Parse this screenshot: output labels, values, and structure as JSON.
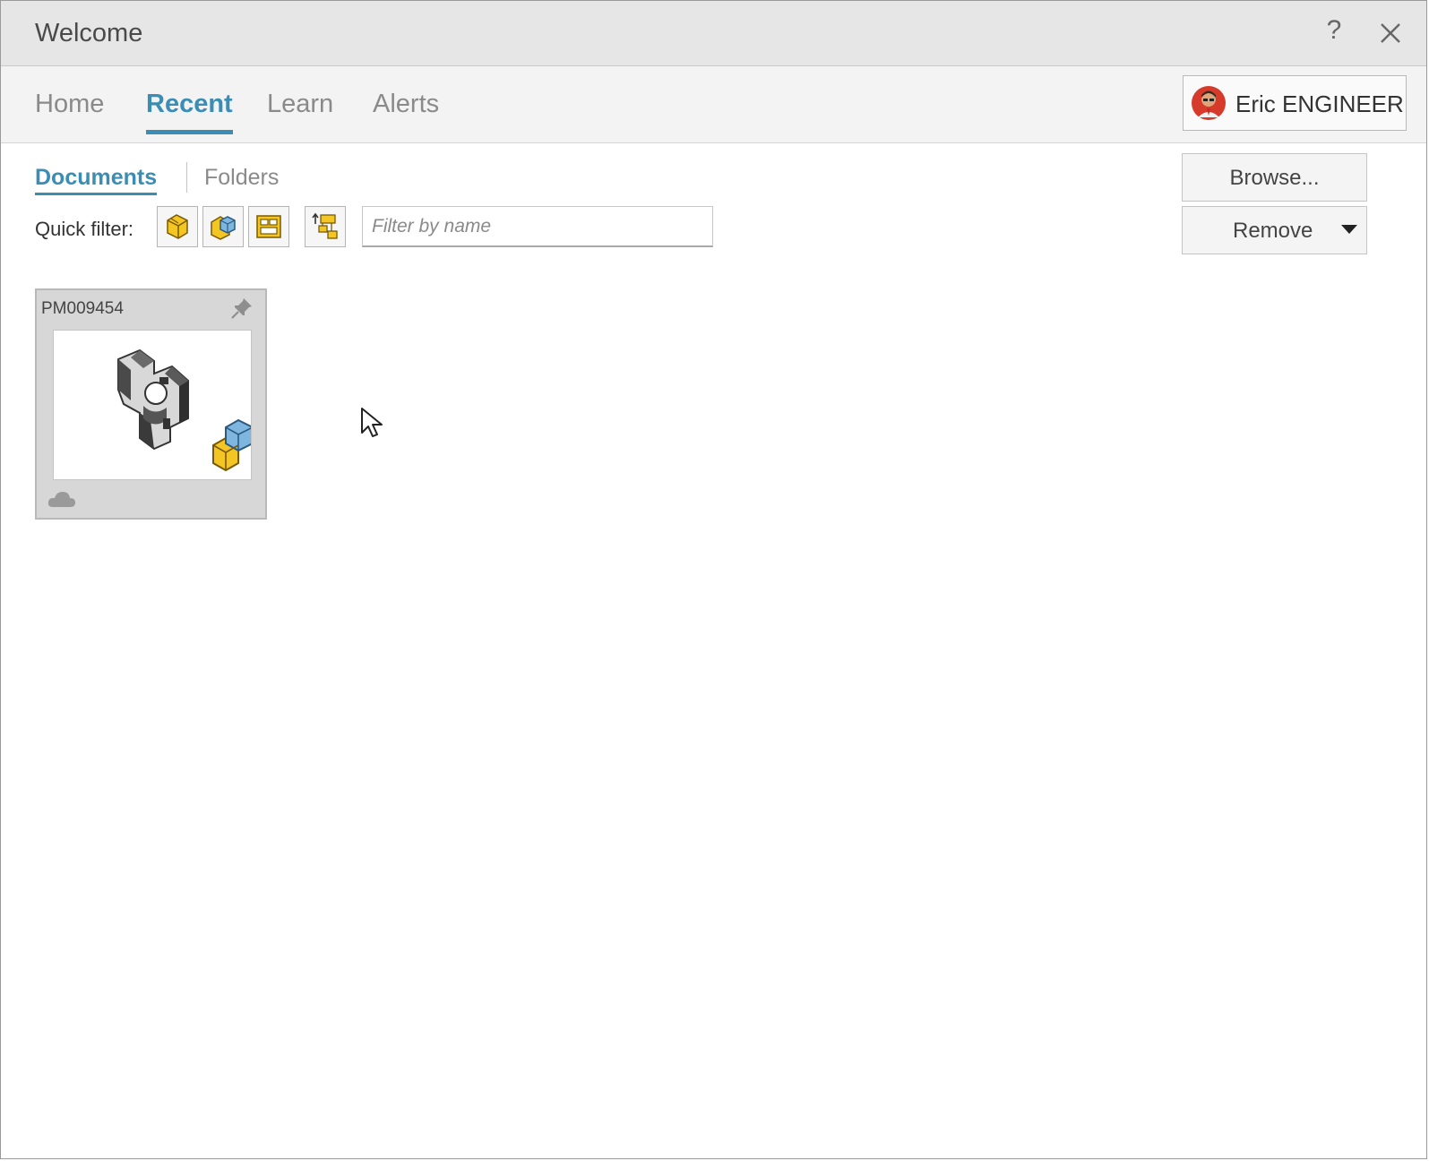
{
  "window": {
    "title": "Welcome",
    "help_symbol": "?",
    "close_icon": "close-icon"
  },
  "nav": {
    "tabs": [
      {
        "label": "Home",
        "active": false
      },
      {
        "label": "Recent",
        "active": true
      },
      {
        "label": "Learn",
        "active": false
      },
      {
        "label": "Alerts",
        "active": false
      }
    ],
    "accent_color": "#3c8db4"
  },
  "user": {
    "name": "Eric ENGINEER",
    "avatar_icon": "user-avatar"
  },
  "subtabs": {
    "documents": "Documents",
    "folders": "Folders",
    "active": "Documents"
  },
  "quick_filter": {
    "label": "Quick filter:",
    "buttons": [
      "part-filter-icon",
      "assembly-filter-icon",
      "drawing-filter-icon",
      "top-level-assembly-filter-icon"
    ],
    "search_placeholder": "Filter by name"
  },
  "actions": {
    "browse_label": "Browse...",
    "remove_label": "Remove"
  },
  "documents": [
    {
      "name": "PM009454",
      "type_icon": "assembly-icon",
      "pin_icon": "pin-icon",
      "location_icon": "cloud-icon"
    }
  ]
}
